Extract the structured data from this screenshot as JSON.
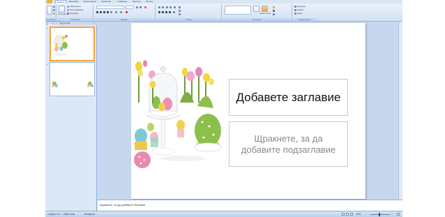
{
  "ribbon": {
    "tabs": [
      {
        "label": "Начало",
        "active": true
      },
      {
        "label": "Вмъкване",
        "active": false
      },
      {
        "label": "Проектиране",
        "active": false
      },
      {
        "label": "Анимации",
        "active": false
      },
      {
        "label": "Слайдшоу",
        "active": false
      },
      {
        "label": "Преглед",
        "active": false
      },
      {
        "label": "Изглед",
        "active": false
      }
    ],
    "groups": [
      {
        "label": "Клипборд"
      },
      {
        "label": "Слайдове"
      },
      {
        "label": "Шрифт"
      },
      {
        "label": "Абзац"
      },
      {
        "label": "Рисуване"
      },
      {
        "label": "Редактиране"
      }
    ],
    "slides_group": {
      "layout_label": "Оформление",
      "reset_label": "Възстановяване",
      "delete_label": "Изтриване",
      "new_slide_label": "Нов слайд"
    },
    "drawing_group": {
      "quick_styles_label": "Бързи стилове"
    },
    "editing_group": {
      "find_label": "Намиране",
      "replace_label": "Замяна",
      "select_label": "Избор"
    }
  },
  "left_panel": {
    "tabs": [
      {
        "label": "Слайдове",
        "active": true
      },
      {
        "label": "Структура",
        "active": false
      }
    ],
    "thumbnails": [
      {
        "number": "1",
        "selected": true
      },
      {
        "number": "2",
        "selected": false
      }
    ]
  },
  "slide": {
    "title_placeholder": "Добавете заглавие",
    "subtitle_placeholder": "Щракнете, за да добавите подзаглавие"
  },
  "notes": {
    "placeholder": "Щракнете, за да добавите бележки"
  },
  "status_bar": {
    "slide_counter": "Слайд 1 от 2",
    "theme": "Office тема",
    "language": "български",
    "zoom": "69%"
  },
  "colors": {
    "ribbon_bg": "#dbe7f6",
    "frame_bg": "#c5d7ee",
    "accent_selected_thumb": "#f4a630",
    "title_text": "#111111",
    "subtitle_text": "#8a8a8a"
  }
}
